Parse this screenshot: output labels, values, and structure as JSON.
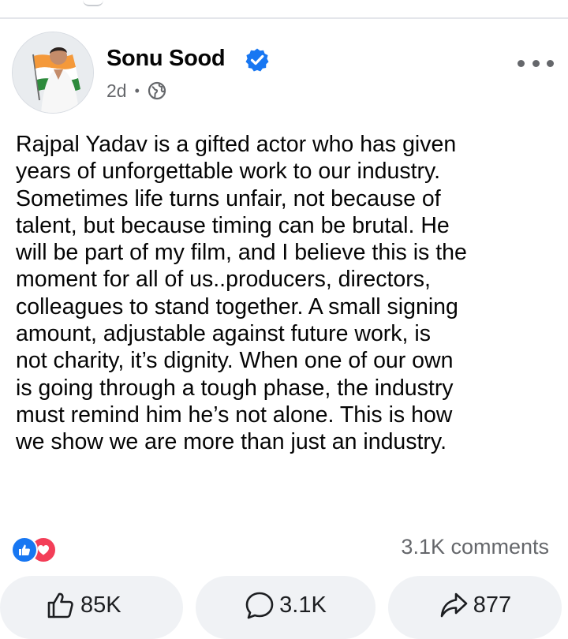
{
  "post": {
    "author": "Sonu Sood",
    "time": "2d",
    "separator": "•",
    "audience_icon": "globe-icon",
    "verified_icon": "verified-badge-icon",
    "text": "Rajpal Yadav is a gifted actor who has given\nyears of unforgettable work to our industry.\nSometimes life turns unfair, not because of\ntalent, but because timing can be brutal. He\nwill be part of my film, and I believe this is the\nmoment for all of us..producers, directors,\ncolleagues to stand together. A small signing\namount, adjustable against future work, is\nnot charity, it’s dignity. When one of our own\nis going through a tough phase, the industry\nmust remind him he’s not alone. This is how\nwe show we are more than just an industry."
  },
  "engagement": {
    "reaction_icons": [
      "like-icon",
      "love-icon"
    ],
    "comments_summary": "3.1K comments",
    "like_count": "85K",
    "comment_count": "3.1K",
    "share_count": "877"
  },
  "colors": {
    "accent": "#1877f2",
    "love": "#f33e58",
    "muted_text": "#65676b",
    "pill_background": "#f0f2f5"
  }
}
